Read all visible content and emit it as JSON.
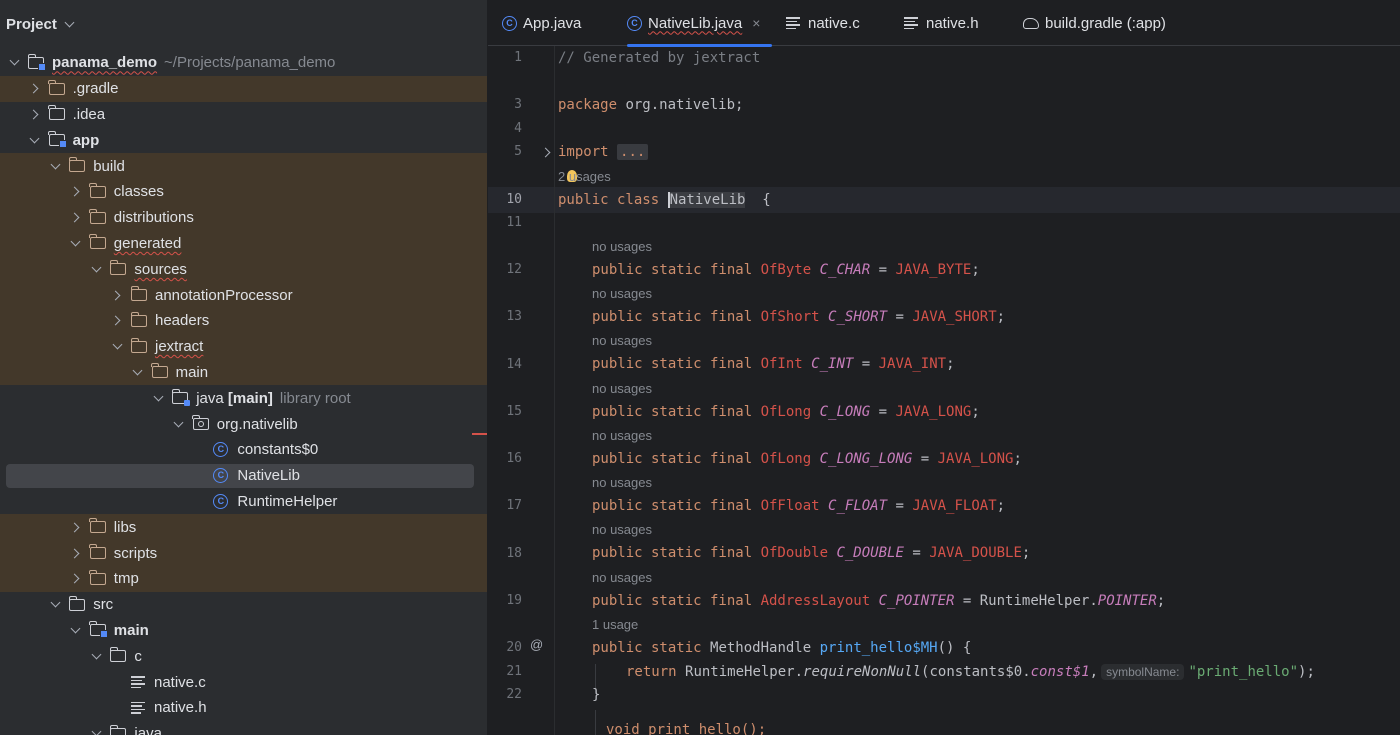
{
  "project_panel": {
    "title": "Project",
    "tree": [
      {
        "label": "panama_demo",
        "hint": "~/Projects/panama_demo",
        "icon": "module-folder-icon",
        "depth": 0,
        "expanded": true,
        "bold": true,
        "wavy": true,
        "excluded": false
      },
      {
        "label": ".gradle",
        "icon": "folder-icon",
        "depth": 1,
        "expanded": false,
        "excluded": true
      },
      {
        "label": ".idea",
        "icon": "folder-plain-icon",
        "depth": 1,
        "expanded": false,
        "excluded": false
      },
      {
        "label": "app",
        "icon": "module-folder-icon",
        "depth": 1,
        "expanded": true,
        "bold": true,
        "excluded": false
      },
      {
        "label": "build",
        "icon": "folder-icon",
        "depth": 2,
        "expanded": true,
        "excluded": true
      },
      {
        "label": "classes",
        "icon": "folder-icon",
        "depth": 3,
        "expanded": false,
        "excluded": true
      },
      {
        "label": "distributions",
        "icon": "folder-icon",
        "depth": 3,
        "expanded": false,
        "excluded": true
      },
      {
        "label": "generated",
        "icon": "folder-icon",
        "depth": 3,
        "expanded": true,
        "wavy": true,
        "excluded": true
      },
      {
        "label": "sources",
        "icon": "folder-icon",
        "depth": 4,
        "expanded": true,
        "wavy": true,
        "excluded": true
      },
      {
        "label": "annotationProcessor",
        "icon": "folder-icon",
        "depth": 5,
        "expanded": false,
        "excluded": true
      },
      {
        "label": "headers",
        "icon": "folder-icon",
        "depth": 5,
        "expanded": false,
        "excluded": true
      },
      {
        "label": "jextract",
        "icon": "folder-icon",
        "depth": 5,
        "expanded": true,
        "wavy": true,
        "excluded": true
      },
      {
        "label": "main",
        "icon": "folder-icon",
        "depth": 6,
        "expanded": true,
        "excluded": true
      },
      {
        "label": "java [main]",
        "hint": "library root",
        "icon": "source-folder-icon",
        "depth": 7,
        "expanded": true,
        "bold_suffix": true,
        "excluded": false
      },
      {
        "label": "org.nativelib",
        "icon": "package-icon",
        "depth": 8,
        "expanded": true,
        "excluded": false
      },
      {
        "label": "constants$0",
        "icon": "class-icon",
        "depth": 9,
        "leaf": true,
        "excluded": false
      },
      {
        "label": "NativeLib",
        "icon": "class-icon",
        "depth": 9,
        "leaf": true,
        "selected": true,
        "excluded": false
      },
      {
        "label": "RuntimeHelper",
        "icon": "class-icon",
        "depth": 9,
        "leaf": true,
        "excluded": false
      },
      {
        "label": "libs",
        "icon": "folder-icon",
        "depth": 3,
        "expanded": false,
        "excluded": true
      },
      {
        "label": "scripts",
        "icon": "folder-icon",
        "depth": 3,
        "expanded": false,
        "excluded": true
      },
      {
        "label": "tmp",
        "icon": "folder-icon",
        "depth": 3,
        "expanded": false,
        "excluded": true
      },
      {
        "label": "src",
        "icon": "folder-plain-icon",
        "depth": 2,
        "expanded": true,
        "excluded": false
      },
      {
        "label": "main",
        "icon": "module-folder-icon",
        "depth": 3,
        "expanded": true,
        "bold": true,
        "excluded": false
      },
      {
        "label": "c",
        "icon": "folder-plain-icon",
        "depth": 4,
        "expanded": true,
        "excluded": false
      },
      {
        "label": "native.c",
        "icon": "text-file-icon",
        "depth": 5,
        "leaf": true,
        "excluded": false
      },
      {
        "label": "native.h",
        "icon": "text-file-icon",
        "depth": 5,
        "leaf": true,
        "excluded": false
      },
      {
        "label": "java",
        "icon": "source-folder-icon",
        "depth": 4,
        "expanded": true,
        "excluded": false
      }
    ]
  },
  "tabs": [
    {
      "label": "App.java",
      "icon": "class-icon",
      "active": false
    },
    {
      "label": "NativeLib.java",
      "icon": "class-icon",
      "active": true,
      "wavy": true,
      "closable": true
    },
    {
      "label": "native.c",
      "icon": "text-file-icon",
      "active": false
    },
    {
      "label": "native.h",
      "icon": "text-file-icon",
      "active": false
    },
    {
      "label": "build.gradle (:app)",
      "icon": "gradle-icon",
      "active": false
    }
  ],
  "close_glyph": "×",
  "editor": {
    "line_numbers": [
      "1",
      "3",
      "4",
      "5",
      "10",
      "11",
      "12",
      "13",
      "14",
      "15",
      "16",
      "17",
      "18",
      "19",
      "20",
      "21",
      "22"
    ],
    "comment": "// Generated by jextract",
    "package_kw": "package",
    "package_name": " org.nativelib;",
    "import_kw": "import",
    "import_fold": "...",
    "usages_class": "2 usages",
    "class_kw": "public class ",
    "class_name": "NativeLib",
    "class_brace": "  {",
    "no_usages": "no usages",
    "one_usage": "1 usage",
    "mod": "public static final ",
    "fields": [
      {
        "type": "OfByte",
        "name": "C_CHAR",
        "value": "JAVA_BYTE"
      },
      {
        "type": "OfShort",
        "name": "C_SHORT",
        "value": "JAVA_SHORT"
      },
      {
        "type": "OfInt",
        "name": "C_INT",
        "value": "JAVA_INT"
      },
      {
        "type": "OfLong",
        "name": "C_LONG",
        "value": "JAVA_LONG"
      },
      {
        "type": "OfLong",
        "name": "C_LONG_LONG",
        "value": "JAVA_LONG"
      },
      {
        "type": "OfFloat",
        "name": "C_FLOAT",
        "value": "JAVA_FLOAT"
      },
      {
        "type": "OfDouble",
        "name": "C_DOUBLE",
        "value": "JAVA_DOUBLE"
      }
    ],
    "pointer_type": "AddressLayout",
    "pointer_name": "C_POINTER",
    "pointer_owner": "RuntimeHelper.",
    "pointer_value": "POINTER",
    "method_mod": "public static ",
    "method_type": "MethodHandle",
    "method_name": "print_hello$MH",
    "method_tail": "() {",
    "return_kw": "return ",
    "return_owner": "RuntimeHelper.",
    "return_call": "requireNonNull",
    "return_arg_open": "(constants$0.",
    "return_arg_const": "const$1",
    "return_comma": ",",
    "param_hint": "symbolName:",
    "return_string": "\"print_hello\"",
    "return_close": ");",
    "close_brace": "}",
    "next_line": "void print_hello();",
    "equals": " = ",
    "semicolon": ";",
    "gutter_marker": "@"
  }
}
